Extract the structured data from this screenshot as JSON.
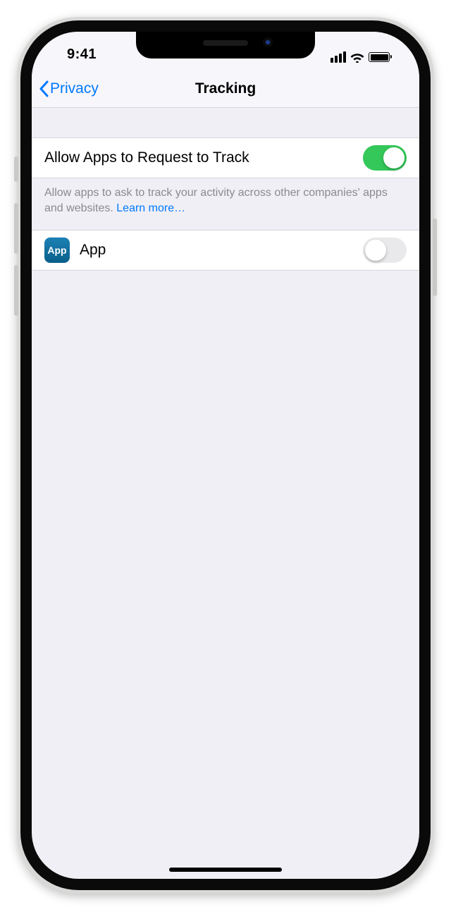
{
  "status": {
    "time": "9:41"
  },
  "nav": {
    "back_label": "Privacy",
    "title": "Tracking"
  },
  "setting_main": {
    "label": "Allow Apps to Request to Track",
    "enabled": true,
    "note_pre": "Allow apps to ask to track your activity across other companies' apps and websites. ",
    "note_link": "Learn more…"
  },
  "apps": [
    {
      "icon_label": "App",
      "name": "App",
      "enabled": false
    }
  ]
}
